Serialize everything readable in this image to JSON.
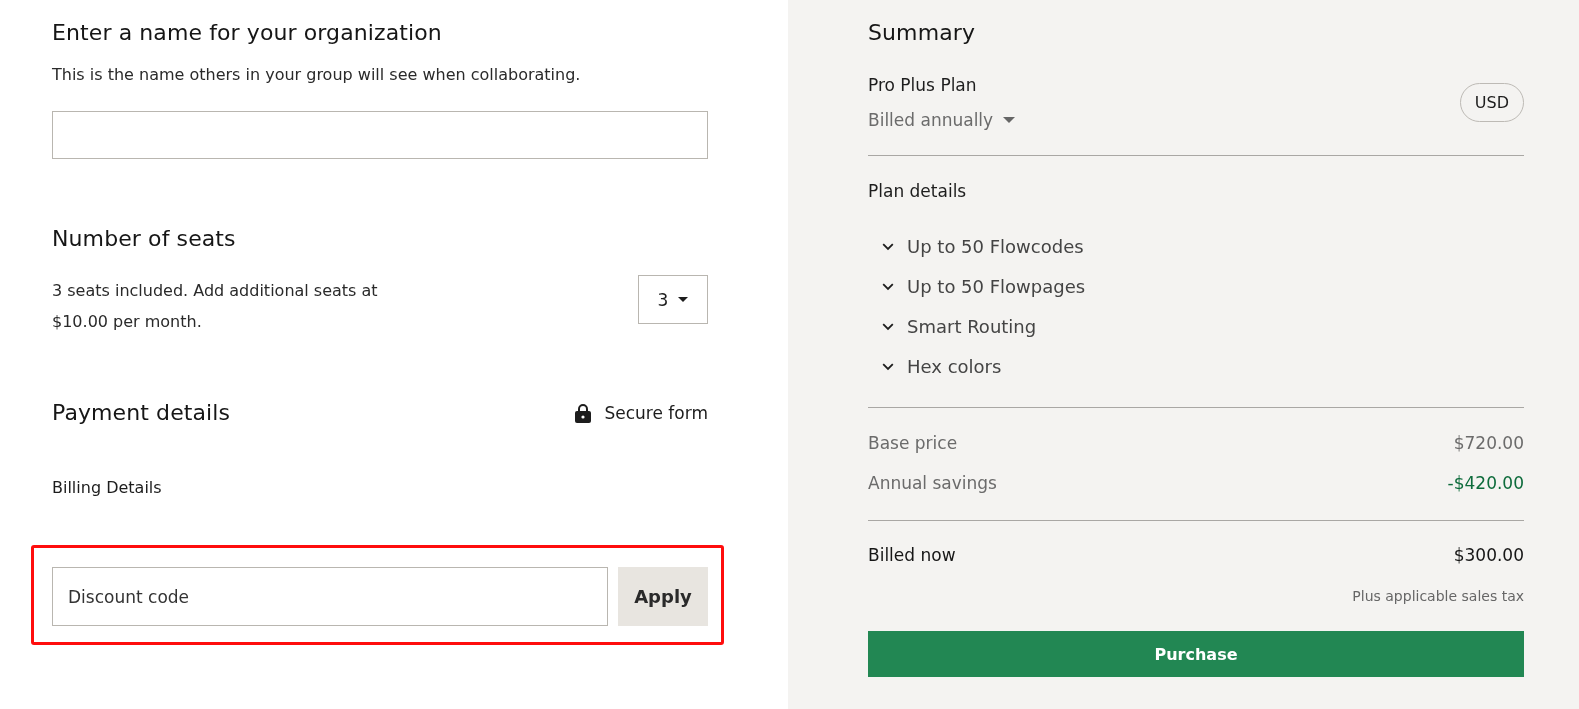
{
  "organization": {
    "title": "Enter a name for your organization",
    "description": "This is the name others in your group will see when collaborating."
  },
  "seats": {
    "title": "Number of seats",
    "description": "3 seats included. Add additional seats at $10.00 per month.",
    "selected_value": "3"
  },
  "payment": {
    "title": "Payment details",
    "secure_label": "Secure form",
    "billing_title": "Billing Details"
  },
  "discount": {
    "placeholder": "Discount code",
    "button": "Apply",
    "highlighted": true
  },
  "summary": {
    "title": "Summary",
    "plan_name": "Pro Plus Plan",
    "billing_period": "Billed annually",
    "currency": "USD",
    "plan_details_title": "Plan details",
    "features": [
      "Up to 50 Flowcodes",
      "Up to 50 Flowpages",
      "Smart Routing",
      "Hex colors"
    ],
    "price_lines": [
      {
        "label": "Base price",
        "amount": "$720.00",
        "kind": "normal"
      },
      {
        "label": "Annual savings",
        "amount": "-$420.00",
        "kind": "discount"
      }
    ],
    "total": {
      "label": "Billed now",
      "amount": "$300.00"
    },
    "tax_note": "Plus applicable sales tax",
    "purchase_button": "Purchase"
  }
}
